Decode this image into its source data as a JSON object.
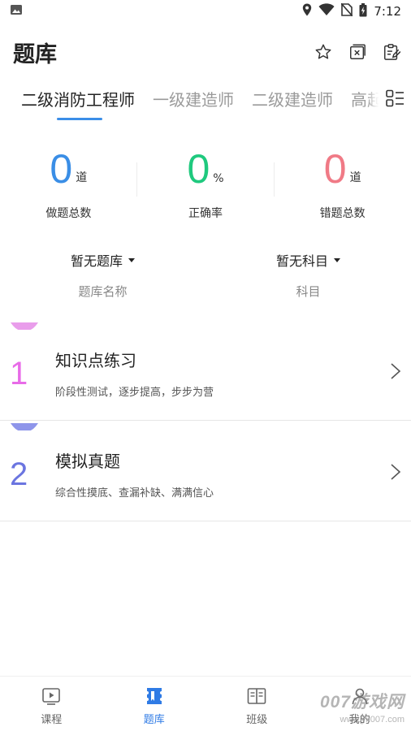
{
  "status_bar": {
    "time": "7:12"
  },
  "header": {
    "title": "题库"
  },
  "tabs": [
    {
      "label": "二级消防工程师",
      "active": true
    },
    {
      "label": "一级建造师",
      "active": false
    },
    {
      "label": "二级建造师",
      "active": false
    },
    {
      "label": "高起",
      "active": false
    }
  ],
  "stats": [
    {
      "value": "0",
      "unit": "道",
      "label": "做题总数",
      "color": "#3a8ee6"
    },
    {
      "value": "0",
      "unit": "%",
      "label": "正确率",
      "color": "#1fc97e"
    },
    {
      "value": "0",
      "unit": "道",
      "label": "错题总数",
      "color": "#f07a86"
    }
  ],
  "pickers": [
    {
      "value": "暂无题库",
      "label": "题库名称"
    },
    {
      "value": "暂无科目",
      "label": "科目"
    }
  ],
  "cards": [
    {
      "number": "1",
      "title": "知识点练习",
      "desc": "阶段性测试，逐步提高，步步为营",
      "color": "#e86be8"
    },
    {
      "number": "2",
      "title": "模拟真题",
      "desc": "综合性摸底、查漏补缺、满满信心",
      "color": "#6b75e0"
    }
  ],
  "bottom_nav": [
    {
      "label": "课程",
      "icon": "play-icon",
      "active": false
    },
    {
      "label": "题库",
      "icon": "question-bank-icon",
      "active": true
    },
    {
      "label": "班级",
      "icon": "book-icon",
      "active": false
    },
    {
      "label": "我的",
      "icon": "profile-icon",
      "active": false
    }
  ],
  "watermark": {
    "main": "007游戏网",
    "url": "www.yx007.com"
  },
  "colors": {
    "accent": "#2f7be5",
    "indicator": "#3b8ee8"
  }
}
